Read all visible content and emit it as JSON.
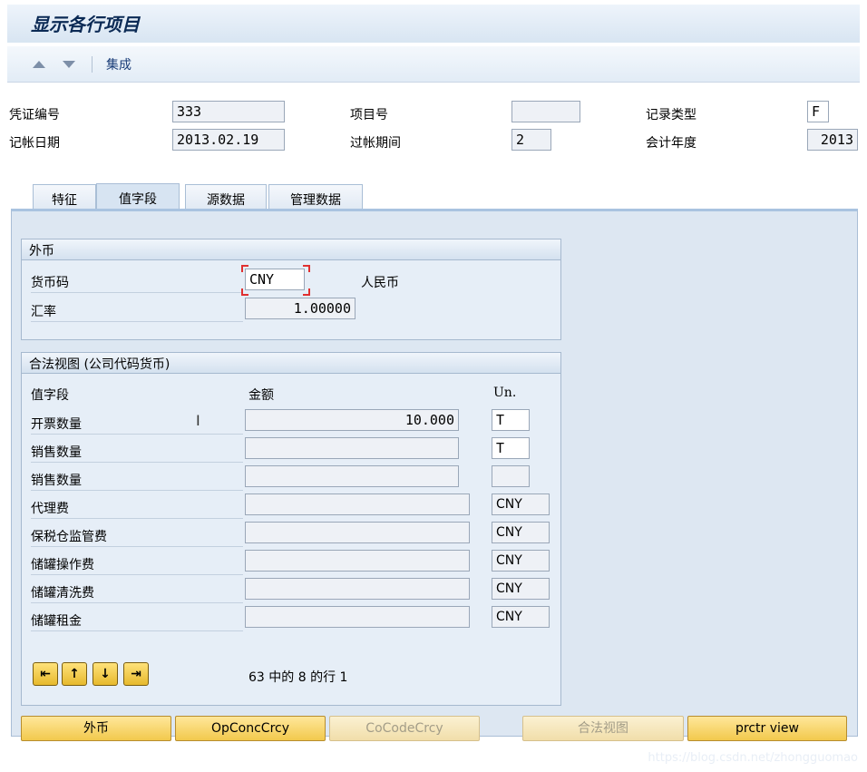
{
  "window": {
    "title": "显示各行项目"
  },
  "toolbar": {
    "collect_label": "集成"
  },
  "header": {
    "doc_no_label": "凭证编号",
    "doc_no": "333",
    "item_no_label": "项目号",
    "item_no": "",
    "record_type_label": "记录类型",
    "record_type": "F",
    "posting_date_label": "记帐日期",
    "posting_date": "2013.02.19",
    "period_label": "过帐期间",
    "period": "2",
    "fiscal_year_label": "会计年度",
    "fiscal_year": "2013"
  },
  "tabs": [
    {
      "label": "特征"
    },
    {
      "label": "值字段",
      "active": true
    },
    {
      "label": "源数据"
    },
    {
      "label": "管理数据"
    }
  ],
  "foreign_currency": {
    "title": "外币",
    "currency_label": "货币码",
    "currency": "CNY",
    "currency_name": "人民币",
    "rate_label": "汇率",
    "rate": "1.00000"
  },
  "legal_view": {
    "title": "合法视图 (公司代码货币)",
    "col_field": "值字段",
    "col_amount": "金额",
    "col_unit": "Un.",
    "rows": [
      {
        "label": "开票数量",
        "amount": "10.000",
        "unit": "T"
      },
      {
        "label": "销售数量",
        "amount": "",
        "unit": "T"
      },
      {
        "label": "销售数量",
        "amount": "",
        "unit": ""
      },
      {
        "label": "代理费",
        "amount": "",
        "unit": "CNY"
      },
      {
        "label": "保税仓监管费",
        "amount": "",
        "unit": "CNY"
      },
      {
        "label": "储罐操作费",
        "amount": "",
        "unit": "CNY"
      },
      {
        "label": "储罐清洗费",
        "amount": "",
        "unit": "CNY"
      },
      {
        "label": "储罐租金",
        "amount": "",
        "unit": "CNY"
      }
    ],
    "paging_text": "63 中的 8 的行 1"
  },
  "buttons": {
    "foreign": "外币",
    "opconc": "OpConcCrcy",
    "cocode": "CoCodeCrcy",
    "legal": "合法视图",
    "prctr": "prctr view"
  },
  "watermark": "https://blog.csdn.net/zhongguomao"
}
